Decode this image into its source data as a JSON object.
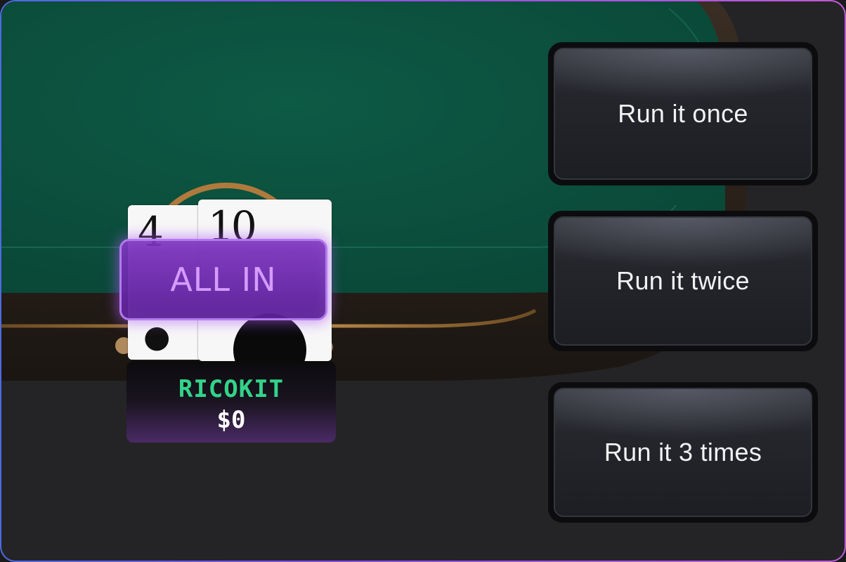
{
  "run_options": {
    "once_label": "Run it once",
    "twice_label": "Run it twice",
    "three_label": "Run it 3 times"
  },
  "player": {
    "name": "RICOKIT",
    "stack": "$0",
    "status": "ALL IN",
    "cards": [
      {
        "rank": "4",
        "suit": "clubs"
      },
      {
        "rank": "10",
        "suit": "spades"
      }
    ]
  },
  "colors": {
    "felt": "#0f5040",
    "allin_border": "#b47af0",
    "name_green": "#33d38a"
  }
}
